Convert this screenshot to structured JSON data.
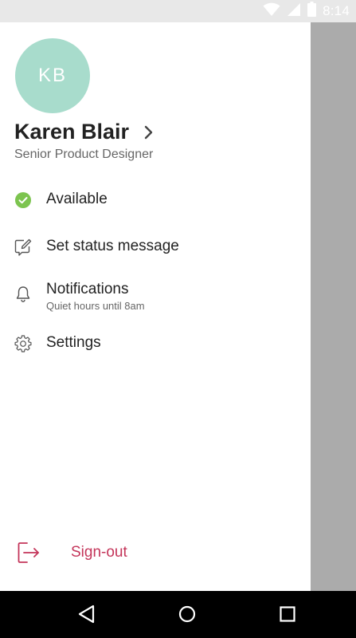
{
  "status_bar": {
    "time": "8:14",
    "icons": [
      "wifi-icon",
      "signal-icon",
      "battery-icon"
    ]
  },
  "profile": {
    "initials": "KB",
    "name": "Karen Blair",
    "title": "Senior Product Designer",
    "avatar_color": "#a8dccc"
  },
  "menu": {
    "items": [
      {
        "label": "Available",
        "icon": "available-check-icon",
        "status_color": "#7cc44f"
      },
      {
        "label": "Set status message",
        "icon": "edit-status-icon"
      },
      {
        "label": "Notifications",
        "sublabel": "Quiet hours until 8am",
        "icon": "bell-icon"
      },
      {
        "label": "Settings",
        "icon": "gear-icon"
      }
    ]
  },
  "signout": {
    "label": "Sign-out",
    "icon": "sign-out-icon",
    "color": "#c4355a"
  },
  "nav_bar": {
    "buttons": [
      "back-icon",
      "home-icon",
      "recents-icon"
    ]
  },
  "colors": {
    "scrim": "#ababab",
    "status_bar_bg": "#e8e8e8"
  }
}
